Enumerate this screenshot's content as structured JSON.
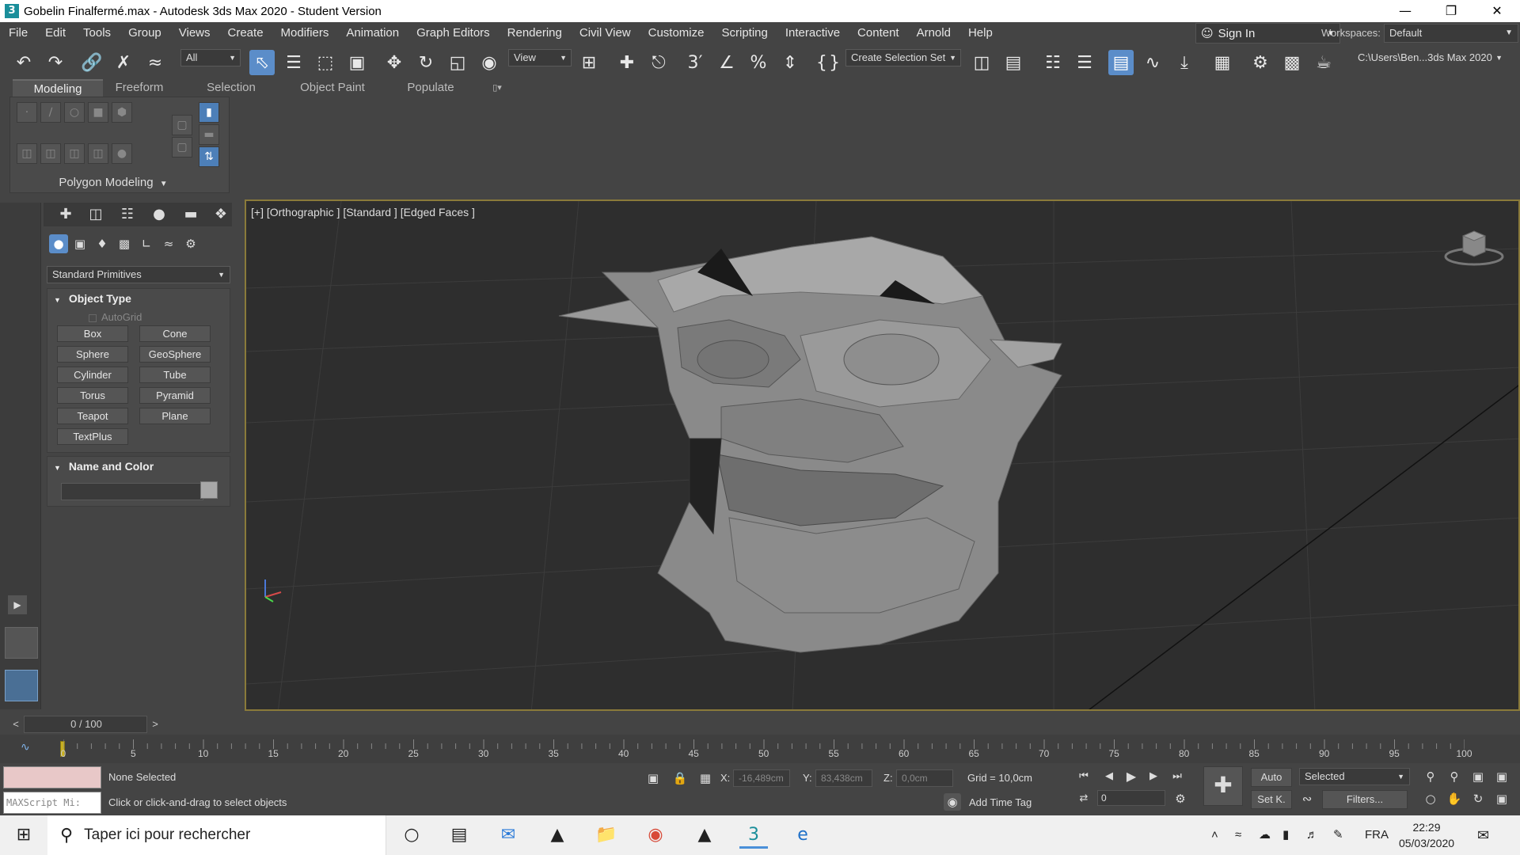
{
  "window": {
    "title": "Gobelin Finalfermé.max - Autodesk 3ds Max 2020 - Student Version",
    "app_icon": "3"
  },
  "menu": [
    "File",
    "Edit",
    "Tools",
    "Group",
    "Views",
    "Create",
    "Modifiers",
    "Animation",
    "Graph Editors",
    "Rendering",
    "Civil View",
    "Customize",
    "Scripting",
    "Interactive",
    "Content",
    "Arnold",
    "Help"
  ],
  "signin": {
    "label": "Sign In"
  },
  "workspace": {
    "label": "Workspaces:",
    "value": "Default"
  },
  "toolbar": {
    "filter_value": "All",
    "refcoord_value": "View",
    "selection_set": "Create Selection Set",
    "project_path": "C:\\Users\\Ben...3ds Max 2020"
  },
  "ribbon": {
    "tabs": [
      "Modeling",
      "Freeform",
      "Selection",
      "Object Paint",
      "Populate"
    ],
    "panel_label": "Polygon Modeling"
  },
  "command_panel": {
    "category": "Standard Primitives",
    "object_type": {
      "title": "Object Type",
      "autogrid": "AutoGrid",
      "buttons": [
        "Box",
        "Cone",
        "Sphere",
        "GeoSphere",
        "Cylinder",
        "Tube",
        "Torus",
        "Pyramid",
        "Teapot",
        "Plane",
        "TextPlus"
      ]
    },
    "name_color": {
      "title": "Name and Color"
    }
  },
  "viewport": {
    "label": "[+] [Orthographic ] [Standard ] [Edged Faces ]"
  },
  "timeline": {
    "frame_text": "0 / 100",
    "ticks": [
      "0",
      "5",
      "10",
      "15",
      "20",
      "25",
      "30",
      "35",
      "40",
      "45",
      "50",
      "55",
      "60",
      "65",
      "70",
      "75",
      "80",
      "85",
      "90",
      "95",
      "100"
    ]
  },
  "status": {
    "maxscript": "MAXScript Mi:",
    "selection": "None Selected",
    "prompt": "Click or click-and-drag to select objects",
    "x_label": "X:",
    "x_value": "-16,489cm",
    "y_label": "Y:",
    "y_value": "83,438cm",
    "z_label": "Z:",
    "z_value": "0,0cm",
    "grid": "Grid = 10,0cm",
    "add_time_tag": "Add Time Tag",
    "auto_key": "Auto",
    "set_key": "Set K.",
    "key_mode": "Selected",
    "filters": "Filters...",
    "frame_value": "0"
  },
  "taskbar": {
    "search_placeholder": "Taper ici pour rechercher",
    "lang": "FRA",
    "time": "22:29",
    "date": "05/03/2020"
  }
}
